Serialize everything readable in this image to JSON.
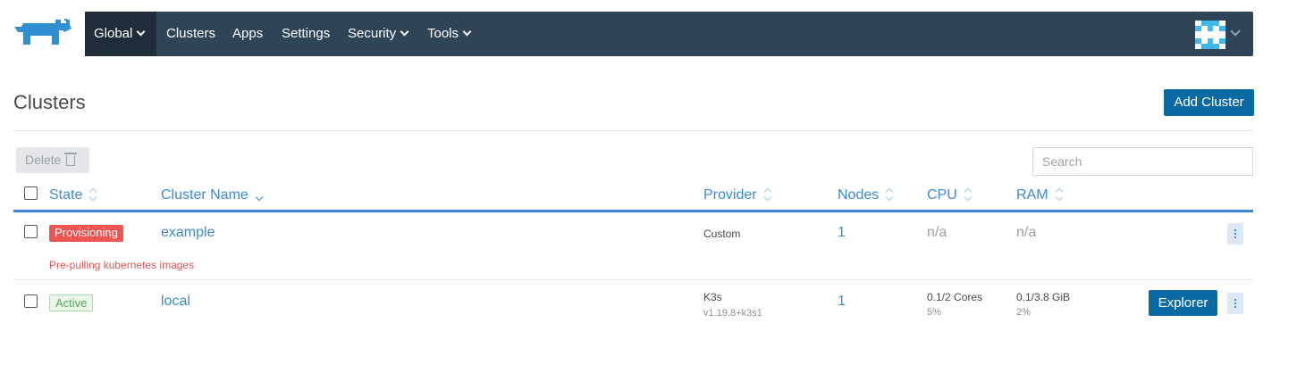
{
  "nav": {
    "items": [
      {
        "label": "Global",
        "has_caret": true,
        "active": true
      },
      {
        "label": "Clusters",
        "has_caret": false
      },
      {
        "label": "Apps",
        "has_caret": false
      },
      {
        "label": "Settings",
        "has_caret": false
      },
      {
        "label": "Security",
        "has_caret": true
      },
      {
        "label": "Tools",
        "has_caret": true
      }
    ],
    "logo_icon": "rancher-logo-icon",
    "avatar_icon": "user-avatar-icon"
  },
  "page": {
    "title": "Clusters",
    "add_button": "Add Cluster",
    "delete_button": "Delete",
    "search_placeholder": "Search"
  },
  "table": {
    "columns": [
      "State",
      "Cluster Name",
      "Provider",
      "Nodes",
      "CPU",
      "RAM"
    ],
    "rows": [
      {
        "state": "Provisioning",
        "state_color": "#ee5451",
        "name": "example",
        "provider": "Custom",
        "provider_version": "",
        "nodes": "1",
        "cpu": "n/a",
        "cpu_pct": "",
        "ram": "n/a",
        "ram_pct": "",
        "message": "Pre-pulling kubernetes images"
      },
      {
        "state": "Active",
        "state_color": "#5aa75d",
        "name": "local",
        "provider": "K3s",
        "provider_version": "v1.19.8+k3s1",
        "nodes": "1",
        "cpu": "0.1/2 Cores",
        "cpu_pct": "5%",
        "ram": "0.1/3.8 GiB",
        "ram_pct": "2%",
        "action": "Explorer"
      }
    ]
  },
  "colors": {
    "nav_bg": "#2f4457",
    "accent": "#3b8ad1",
    "primary_button": "#0b6aa3"
  }
}
